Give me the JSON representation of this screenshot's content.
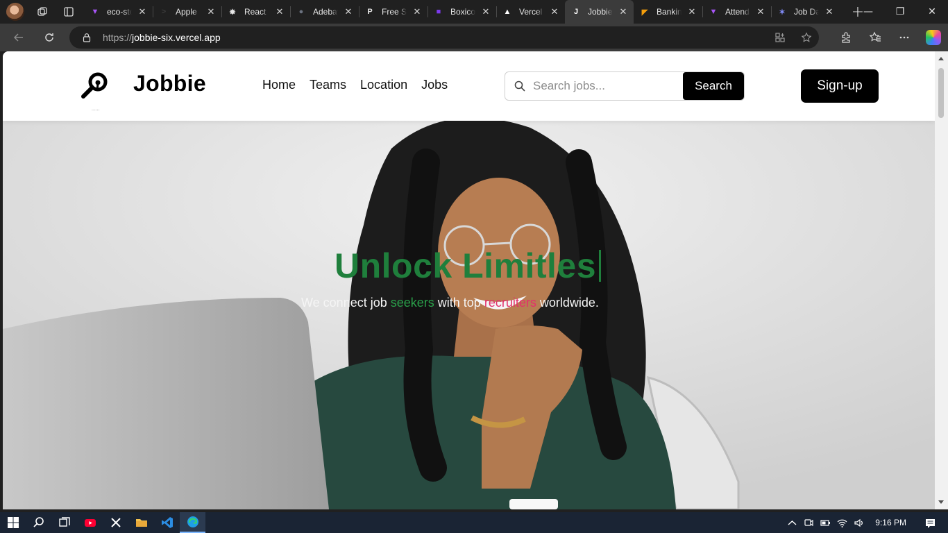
{
  "browser": {
    "tabs": [
      {
        "label": "eco-store",
        "favicon": "vite-icon",
        "color": "#a855f7"
      },
      {
        "label": "Apple",
        "favicon": "terminal-icon",
        "color": "#3b3b3b"
      },
      {
        "label": "React",
        "favicon": "openai-icon",
        "color": "#e6e6e6"
      },
      {
        "label": "Adebayo",
        "favicon": "avatar-icon",
        "color": "#6b7280"
      },
      {
        "label": "Free Stock",
        "favicon": "pexels-icon",
        "color": "#e6e6e6"
      },
      {
        "label": "Boxicons",
        "favicon": "box-icon",
        "color": "#7c3aed"
      },
      {
        "label": "Vercel",
        "favicon": "vercel-icon",
        "color": "#ffffff"
      },
      {
        "label": "Jobbie",
        "favicon": "jobbie-icon",
        "color": "#ffffff",
        "active": true
      },
      {
        "label": "Banking",
        "favicon": "banking-icon",
        "color": "#f59e0b"
      },
      {
        "label": "Attendance",
        "favicon": "vite-icon",
        "color": "#a855f7"
      },
      {
        "label": "Job Dashboard",
        "favicon": "star-icon",
        "color": "#818cf8"
      }
    ],
    "url_protocol": "https://",
    "url_host": "jobbie-six.vercel.app"
  },
  "site": {
    "brand": "Jobbie",
    "logo_caption": "......",
    "nav": [
      "Home",
      "Teams",
      "Location",
      "Jobs"
    ],
    "search": {
      "placeholder": "Search jobs...",
      "button": "Search"
    },
    "signup": "Sign-up"
  },
  "hero": {
    "title": "Unlock Limitles",
    "subtitle_parts": {
      "a": "We connect job ",
      "b": "seekers",
      "c": " with top ",
      "d": "recruiters",
      "e": " worldwide."
    },
    "title_color": "#1f7f3c",
    "seekers_color": "#2aa04a",
    "recruiters_color": "#e3306b"
  },
  "taskbar": {
    "apps": [
      "windows-start-icon",
      "search-icon",
      "task-view-icon",
      "youtube-icon",
      "x-icon",
      "file-explorer-icon",
      "vscode-icon",
      "edge-icon"
    ],
    "time": "9:16 PM"
  }
}
